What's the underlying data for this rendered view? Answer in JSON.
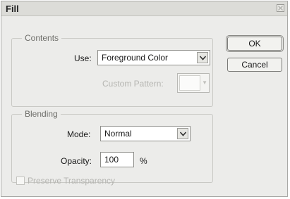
{
  "dialog": {
    "title": "Fill",
    "close_icon": "close-icon"
  },
  "contents": {
    "legend": "Contents",
    "use_label": "Use:",
    "use_value": "Foreground Color",
    "custom_pattern_label": "Custom Pattern:"
  },
  "blending": {
    "legend": "Blending",
    "mode_label": "Mode:",
    "mode_value": "Normal",
    "opacity_label": "Opacity:",
    "opacity_value": "100",
    "opacity_unit": "%"
  },
  "preserve_transparency_label": "Preserve Transparency",
  "buttons": {
    "ok": "OK",
    "cancel": "Cancel"
  }
}
